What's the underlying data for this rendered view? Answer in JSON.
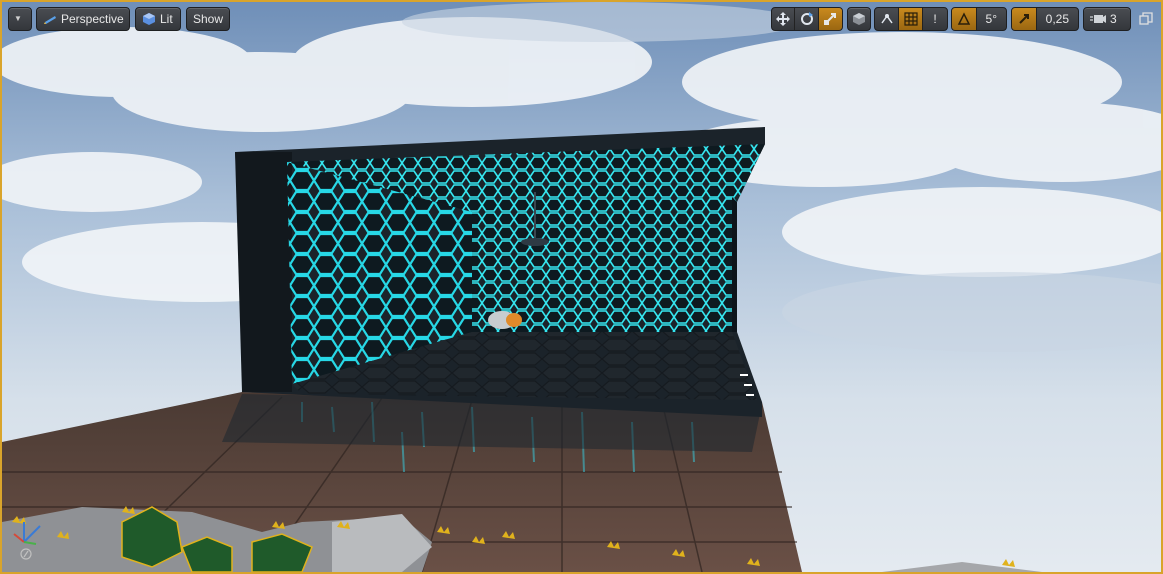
{
  "toolbar": {
    "menu_label": "",
    "perspective_label": "Perspective",
    "lit_label": "Lit",
    "show_label": "Show",
    "grid_snap_value": "!",
    "rotation_snap_value": "5°",
    "scale_snap_value": "0,25",
    "camera_speed_value": "3"
  },
  "colors": {
    "accent": "#d9a42b",
    "button_active": "#c98a1e",
    "hex_glow": "#27d8e6"
  },
  "icons": [
    "menu-caret-icon",
    "perspective-cube-icon",
    "lit-sphere-icon",
    "translate-icon",
    "rotate-icon",
    "scale-icon",
    "world-local-icon",
    "surface-snap-icon",
    "grid-snap-icon",
    "rotation-snap-icon",
    "scale-snap-icon",
    "camera-speed-icon",
    "maximize-icon",
    "axis-gizmo-icon"
  ]
}
